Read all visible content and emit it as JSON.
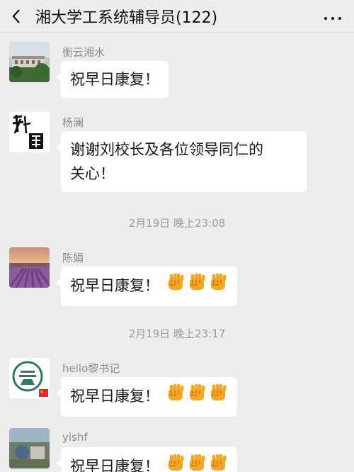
{
  "header": {
    "back_icon": "chevron-left-icon",
    "title": "湘大学工系统辅导员(122)",
    "more_icon": "more-dots-icon"
  },
  "messages": [
    {
      "sender": "衡云湘水",
      "text": "祝早日康复！",
      "avatar": "campus-building-photo",
      "emojis": 0
    },
    {
      "sender": "杨澜",
      "text_line1": "谢谢刘校长及各位领导同仁的",
      "text_line2": "关心！",
      "avatar": "calligraphy-avatar",
      "emojis": 0
    },
    {
      "sender": "陈娟",
      "text": "祝早日康复！",
      "avatar": "lavender-field-photo",
      "emojis": 3,
      "emoji_icon": "fist-emoji-icon"
    },
    {
      "sender": "hello黎书记",
      "text": "祝早日康复！",
      "avatar": "school-logo-avatar",
      "emojis": 3,
      "emoji_icon": "fist-emoji-icon"
    },
    {
      "sender": "yishf",
      "text": "祝早日康复！",
      "avatar": "outdoor-photo",
      "emojis": 3,
      "emoji_icon": "fist-emoji-icon"
    }
  ],
  "timestamps": [
    "2月19日 晚上23:08",
    "2月19日 晚上23:17"
  ],
  "colors": {
    "background": "#ededed",
    "bubble": "#ffffff",
    "secondary_text": "#8c8c8c",
    "emoji": "#f5a623"
  }
}
